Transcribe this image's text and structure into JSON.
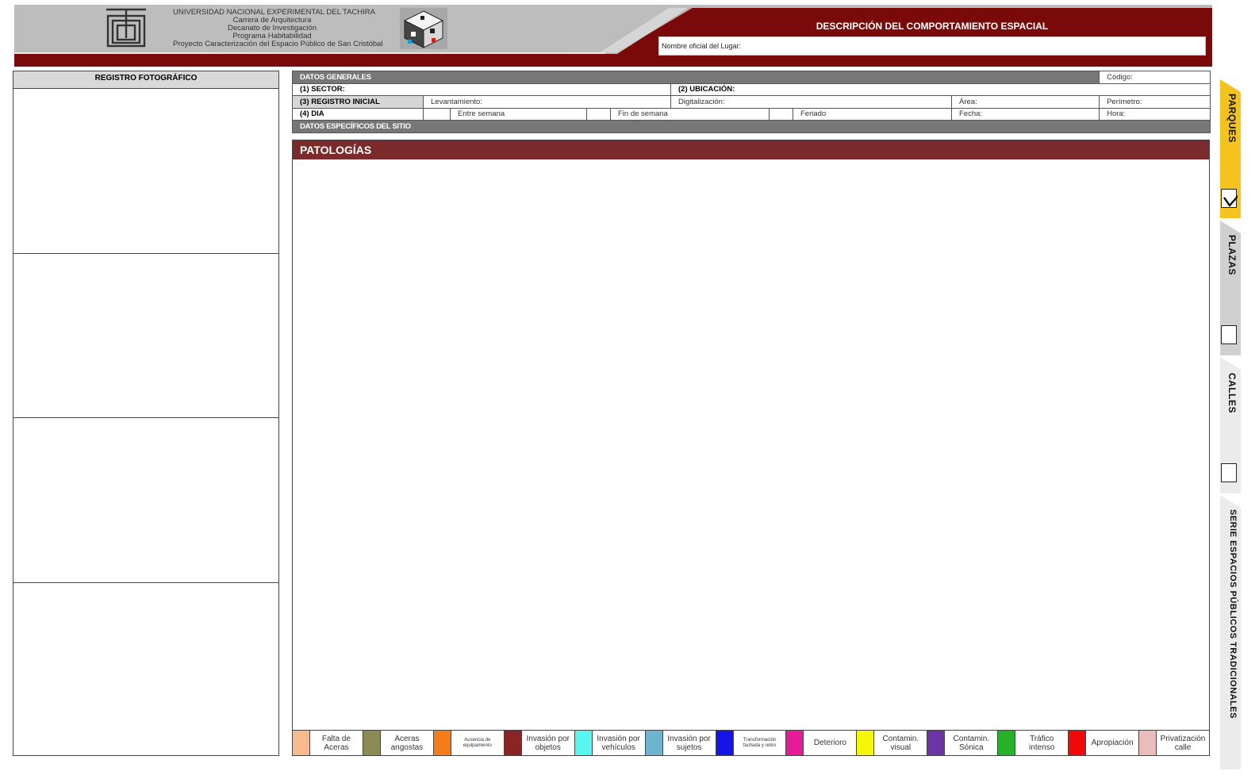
{
  "header": {
    "institution_lines": [
      "UNIVERSIDAD NACIONAL EXPERIMENTAL DEL TACHIRA",
      "Carrera de Arquitectura",
      "Decanato de Investigación",
      "Programa Habitabilidad",
      "Proyecto Caracterización del Espacio Público de San Cristóbal"
    ],
    "form_title": "DESCRIPCIÓN  DEL COMPORTAMIENTO  ESPACIAL",
    "place_label": "Nombre oficial del Lugar:"
  },
  "photo_register": {
    "title": "REGISTRO FOTOGRÁFICO"
  },
  "general_data": {
    "title": "DATOS GENERALES",
    "code_label": "Código:",
    "sector_label": "(1) SECTOR:",
    "location_label": "(2) UBICACIÓN:",
    "initial_record_label": "(3) REGISTRO INICIAL",
    "survey_label": "Levantamiento:",
    "digitization_label": "Digitalización:",
    "area_label": "Área:",
    "perimeter_label": "Perímetro:",
    "day_label": "(4) DIA",
    "weekday_label": "Entre semana",
    "weekend_label": "Fin de semana",
    "holiday_label": "Feriado",
    "date_label": "Fecha:",
    "time_label": "Hora:",
    "site_data_title": "DATOS ESPECÍFICOS DEL SITIO"
  },
  "pathologies": {
    "title": "PATOLOGÍAS",
    "legend": [
      {
        "label": "Falta de Aceras",
        "color": "#f8b98e"
      },
      {
        "label": "Aceras angostas",
        "color": "#8c8a55"
      },
      {
        "label": "Ausencia de equipamiento",
        "color": "#f47c1b",
        "small": true
      },
      {
        "label": "Invasión por objetos",
        "color": "#8b2424"
      },
      {
        "label": "Invasión por vehículos",
        "color": "#59f6f0"
      },
      {
        "label": "Invasión por sujetos",
        "color": "#6eb4cf"
      },
      {
        "label": "Transformación fachada y retiro",
        "color": "#1515e6",
        "small": true
      },
      {
        "label": "Deterioro",
        "color": "#e61b96"
      },
      {
        "label": "Contamin. visual",
        "color": "#f6f60a"
      },
      {
        "label": "Contamin. Sónica",
        "color": "#6d34a6"
      },
      {
        "label": "Tráfico intenso",
        "color": "#27b02a"
      },
      {
        "label": "Apropiación",
        "color": "#f10808"
      },
      {
        "label": "Privatización calle",
        "color": "#ebbcbc"
      }
    ]
  },
  "side_tabs": [
    {
      "label": "PARQUES",
      "checked": true,
      "color": "#f5c31e"
    },
    {
      "label": "PLAZAS",
      "checked": false,
      "color": "#d0d0d0"
    },
    {
      "label": "CALLES",
      "checked": false,
      "color": "#ebebeb"
    },
    {
      "label": "SERIE ESPACIOS PÚBLICOS TRADICIONALES",
      "color": "#ebebeb"
    }
  ],
  "colors": {
    "brand_red": "#7a0a0a",
    "header_gray": "#bdbdbd",
    "section_dark_gray": "#777777",
    "section_light_gray": "#d6d6d6",
    "pathologies_title": "#7b2b2b",
    "parques_tab": "#f5c31e"
  }
}
